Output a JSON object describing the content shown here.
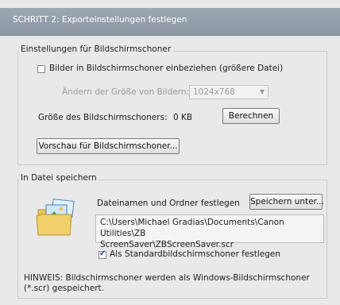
{
  "title": "SCHRITT 2: Exporteinstellungen festlegen",
  "screensaver_settings": {
    "group_label": "Einstellungen für Bildschirmschoner",
    "include_images_label": "Bilder in Bildschirmschoner einbeziehen (größere Datei)",
    "include_images_checked": false,
    "resize_label": "Ändern der Größe von Bildern:",
    "resize_value": "1024x768",
    "size_label": "Größe des Bildschirmschoners:",
    "size_value": "0 KB",
    "calculate_button": "Berechnen",
    "preview_button": "Vorschau für Bildschirmschoner..."
  },
  "save_to_file": {
    "group_label": "In Datei speichern",
    "filename_label": "Dateinamen und Ordner festlegen",
    "save_as_button": "Speichern unter...",
    "path_line1": "C:\\Users\\Michael Gradias\\Documents\\Canon Utilities\\ZB",
    "path_line2": "ScreenSaver\\ZBScreenSaver.scr",
    "set_default_label": "Als Standardbildschirmschoner festlegen",
    "set_default_checked": true
  },
  "note": "HINWEIS: Bildschirmschoner werden als Windows-Bildschirmschoner (*.scr) gespeichert."
}
